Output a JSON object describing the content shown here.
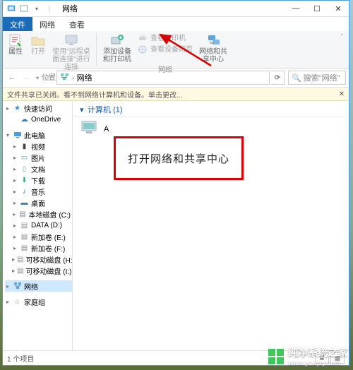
{
  "titlebar": {
    "title": "网络"
  },
  "winbuttons": {
    "min": "—",
    "max": "☐",
    "close": "✕"
  },
  "tabs": {
    "file": "文件",
    "network": "网络",
    "view": "查看"
  },
  "ribbon": {
    "properties": "属性",
    "open": "打开",
    "remote_desktop": "使用\"远程桌面连接\"进行连接",
    "group_location": "位置",
    "add_device": "添加设备和打印机",
    "view_printers": "查看打印机",
    "view_device_page": "查看设备网页",
    "net_sharing_center": "网络和共享中心",
    "group_network": "网络"
  },
  "nav": {
    "crumb_root_icon": "🖧",
    "crumb_network": "网络",
    "search_placeholder": "搜索\"网络\""
  },
  "infobar": {
    "text": "文件共享已关闭。看不到网络计算机和设备。单击更改..."
  },
  "sidebar": {
    "quick_access": "快速访问",
    "onedrive": "OneDrive",
    "this_pc": "此电脑",
    "videos": "视频",
    "pictures": "图片",
    "documents": "文档",
    "downloads": "下载",
    "music": "音乐",
    "desktop": "桌面",
    "disk_c": "本地磁盘 (C:)",
    "disk_d": "DATA (D:)",
    "disk_e": "新加卷 (E:)",
    "disk_f": "新加卷 (F:)",
    "disk_h": "可移动磁盘 (H:)",
    "disk_i": "可移动磁盘 (I:)",
    "network": "网络",
    "homegroup": "家庭组"
  },
  "content": {
    "section_label": "计算机 (1)",
    "item_a": "A"
  },
  "callout": {
    "text": "打开网络和共享中心"
  },
  "statusbar": {
    "count": "1 个项目"
  },
  "watermark": {
    "title": "纯净系统之家",
    "url": "www.ycwjzy.com"
  }
}
